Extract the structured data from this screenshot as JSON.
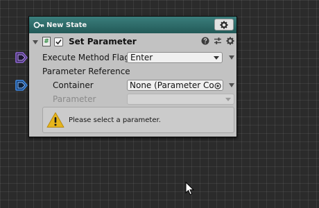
{
  "state": {
    "title": "New State",
    "settings_icon": "gear-icon"
  },
  "behaviour": {
    "title": "Set Parameter",
    "script_glyph": "#",
    "enabled": true,
    "icons": [
      "help-icon",
      "preset-icon",
      "gear-icon"
    ]
  },
  "fields": {
    "execute_method_flag": {
      "label": "Execute Method Flag",
      "value": "Enter"
    },
    "parameter_reference": {
      "label": "Parameter Reference"
    },
    "container": {
      "label": "Container",
      "value": "None (Parameter Con"
    },
    "parameter": {
      "label": "Parameter",
      "value": ""
    }
  },
  "help": {
    "text": "Please select a parameter.",
    "icon": "warning-icon"
  },
  "colors": {
    "header": "#2f6d6b",
    "port_purple": "#7b4fc6",
    "port_blue": "#2f78d6",
    "warning": "#e6b51c"
  }
}
